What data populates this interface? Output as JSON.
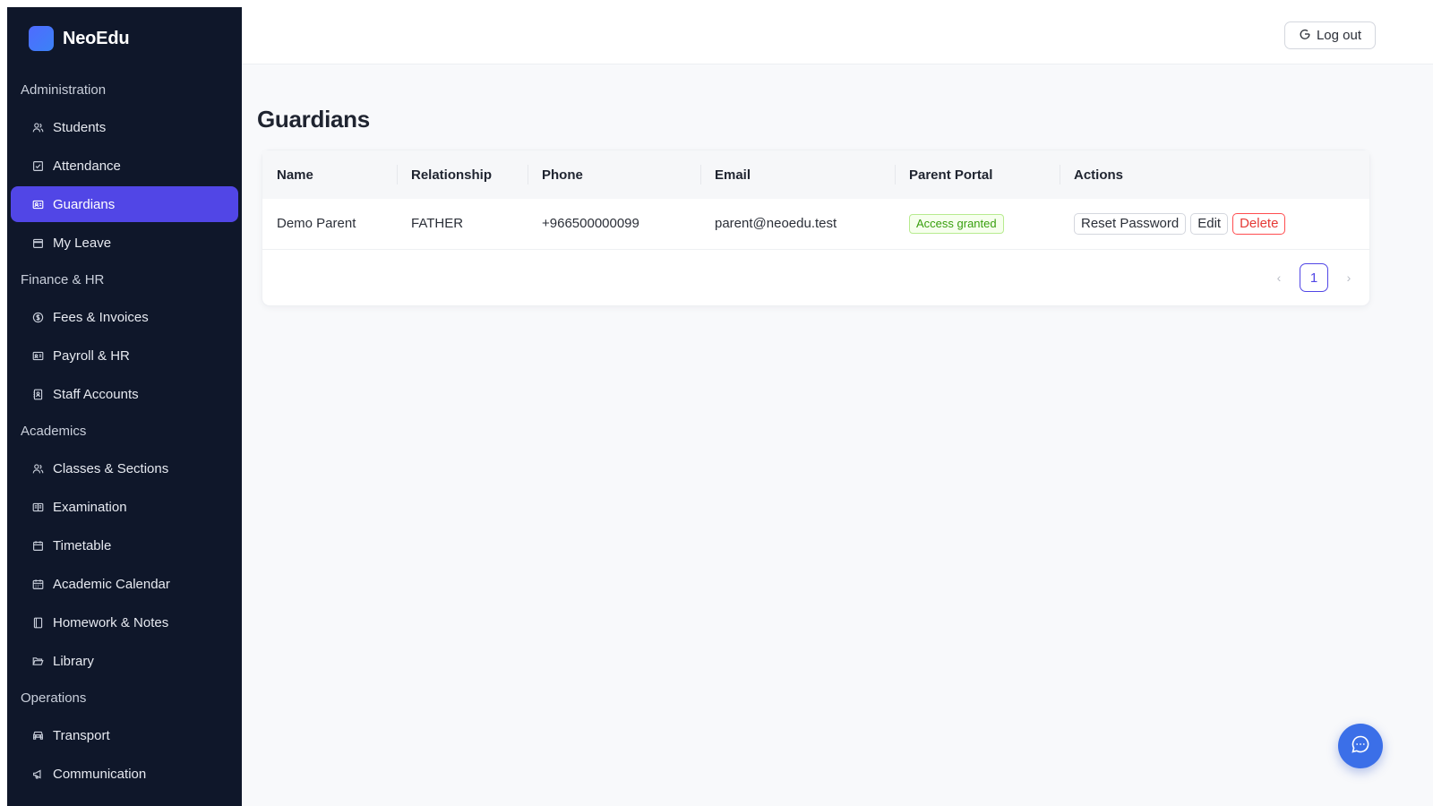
{
  "brand": {
    "name": "NeoEdu"
  },
  "sidebar": {
    "sections": [
      {
        "label": "Administration",
        "items": [
          {
            "label": "Students",
            "icon": "users-icon"
          },
          {
            "label": "Attendance",
            "icon": "check-square-icon"
          },
          {
            "label": "Guardians",
            "icon": "id-card-icon",
            "active": true
          },
          {
            "label": "My Leave",
            "icon": "calendar-icon"
          }
        ]
      },
      {
        "label": "Finance & HR",
        "items": [
          {
            "label": "Fees & Invoices",
            "icon": "dollar-circle-icon"
          },
          {
            "label": "Payroll & HR",
            "icon": "id-badge-icon"
          },
          {
            "label": "Staff Accounts",
            "icon": "contacts-book-icon"
          }
        ]
      },
      {
        "label": "Academics",
        "items": [
          {
            "label": "Classes & Sections",
            "icon": "users-icon"
          },
          {
            "label": "Examination",
            "icon": "book-open-icon"
          },
          {
            "label": "Timetable",
            "icon": "calendar-icon"
          },
          {
            "label": "Academic Calendar",
            "icon": "calendar-grid-icon"
          },
          {
            "label": "Homework & Notes",
            "icon": "notebook-icon"
          },
          {
            "label": "Library",
            "icon": "folder-open-icon"
          }
        ]
      },
      {
        "label": "Operations",
        "items": [
          {
            "label": "Transport",
            "icon": "car-icon"
          },
          {
            "label": "Communication",
            "icon": "megaphone-icon"
          }
        ]
      }
    ]
  },
  "header": {
    "logout_label": "Log out"
  },
  "page": {
    "title": "Guardians"
  },
  "table": {
    "columns": [
      "Name",
      "Relationship",
      "Phone",
      "Email",
      "Parent Portal",
      "Actions"
    ],
    "rows": [
      {
        "name": "Demo Parent",
        "relationship": "FATHER",
        "phone": "+966500000099",
        "email": "parent@neoedu.test",
        "portal": "Access granted",
        "actions": {
          "reset": "Reset Password",
          "edit": "Edit",
          "delete": "Delete"
        }
      }
    ]
  },
  "pagination": {
    "current_page": "1",
    "prev": "‹",
    "next": "›"
  },
  "colors": {
    "sidebar_bg": "#0f172a",
    "accent": "#5146e6",
    "danger": "#e53935",
    "success": "#389e0d",
    "fab": "#3b6fe8"
  }
}
